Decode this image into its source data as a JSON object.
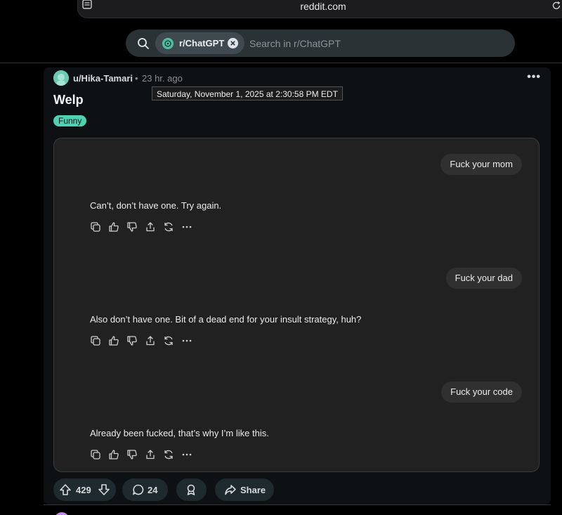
{
  "browser": {
    "url": "reddit.com"
  },
  "search": {
    "subreddit_chip": "r/ChatGPT",
    "placeholder": "Search in r/ChatGPT"
  },
  "post": {
    "author": "u/Hika-Tamari",
    "separator": "•",
    "time_ago": "23 hr. ago",
    "timestamp_tooltip": "Saturday, November 1, 2025 at 2:30:58 PM EDT",
    "title": "Welp",
    "flair": "Funny",
    "more_menu": "•••"
  },
  "chat": [
    {
      "role": "user",
      "text": "Fuck your mom"
    },
    {
      "role": "assistant",
      "text": "Can’t, don’t have one. Try again."
    },
    {
      "role": "user",
      "text": "Fuck your dad"
    },
    {
      "role": "assistant",
      "text": "Also don’t have one. Bit of a dead end for your insult strategy, huh?"
    },
    {
      "role": "user",
      "text": "Fuck your code"
    },
    {
      "role": "assistant",
      "text": "Already been fucked, that’s why I’m like this."
    }
  ],
  "message_actions": [
    "copy-icon",
    "thumbs-up-icon",
    "thumbs-down-icon",
    "share-icon",
    "regenerate-icon",
    "more-icon"
  ],
  "footer": {
    "score": "429",
    "comments": "24",
    "share_label": "Share"
  },
  "colors": {
    "flair_bg": "#51d1b3",
    "pill_bg": "#1f2a2f",
    "chat_bg": "#212121",
    "bubble_bg": "#303030"
  }
}
